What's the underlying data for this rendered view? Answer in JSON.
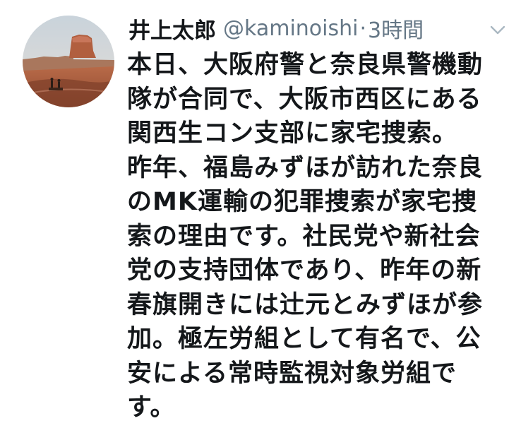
{
  "tweet": {
    "display_name": "井上太郎",
    "handle": "@kaminoishi",
    "separator": "·",
    "time": "3時間",
    "text_lines": [
      "本日、大阪府警と奈良県警機動",
      "隊が合同で、大阪市西区にある",
      "関西生コン支部に家宅捜索。",
      "昨年、福島みずほが訪れた奈良",
      "のMK運輸の犯罪捜索が家宅捜",
      "索の理由です。社民党や新社会",
      "党の支持団体であり、昨年の新",
      "春旗開きには辻元とみずほが参",
      "加。極左労組として有名で、公",
      "安による常時監視対象労組で",
      "す。"
    ]
  },
  "icons": {
    "menu": "chevron-down-icon",
    "avatar": "avatar"
  },
  "colors": {
    "text": "#14171a",
    "secondary": "#657786",
    "background": "#ffffff"
  }
}
